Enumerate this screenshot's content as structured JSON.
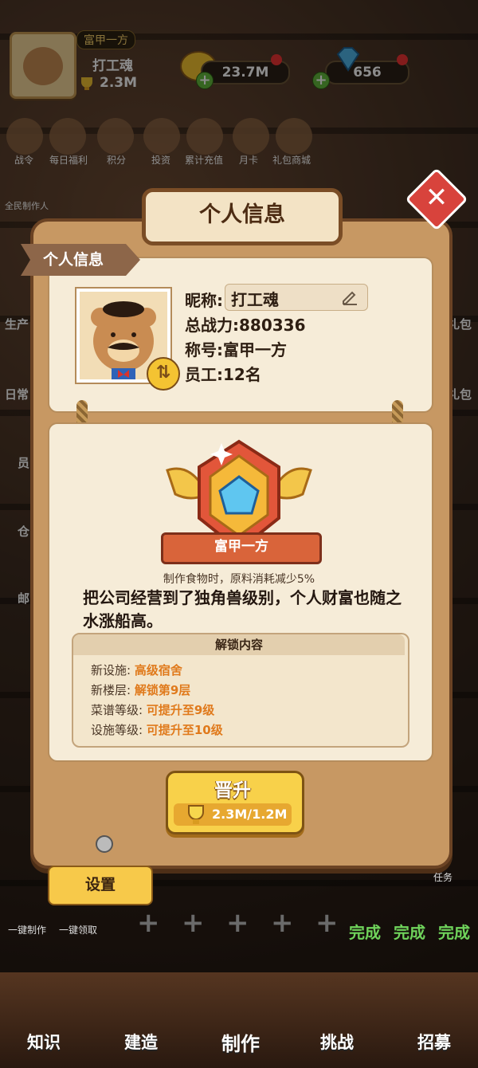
{
  "hud": {
    "rank_tag": "富甲一方",
    "player_name": "打工魂",
    "power": "2.3M",
    "coins": "23.7M",
    "gems": "656"
  },
  "top_row": [
    {
      "label": "战令"
    },
    {
      "label": "每日福利"
    },
    {
      "label": "积分"
    },
    {
      "label": "投资"
    },
    {
      "label": "累计充值"
    },
    {
      "label": "月卡"
    },
    {
      "label": "礼包商城"
    }
  ],
  "side_left": [
    "全民制作人",
    "生产",
    "日常",
    "员",
    "仓",
    "邮"
  ],
  "side_right": [
    "礼包",
    "礼包"
  ],
  "modal": {
    "title": "个人信息",
    "section_ribbon": "个人信息",
    "nickname_label": "昵称:",
    "nickname_value": "打工魂",
    "power_line": "总战力:880336",
    "title_line": "称号:富甲一方",
    "staff_line": "员工:12名",
    "badge_name": "富甲一方",
    "effect": "制作食物时，原料消耗减少5%",
    "description": "把公司经营到了独角兽级别，个人财富也随之水涨船高。",
    "unlock_header": "解锁内容",
    "unlocks": [
      {
        "key": "新设施:",
        "value": "高级宿舍"
      },
      {
        "key": "新楼层:",
        "value": "解锁第9层"
      },
      {
        "key": "菜谱等级:",
        "value": "可提升至9级"
      },
      {
        "key": "设施等级:",
        "value": "可提升至10级"
      }
    ],
    "promote_label": "晋升",
    "promote_cost": "2.3M/1.2M"
  },
  "settings_label": "设置",
  "quick": {
    "one_make": "一键制作",
    "one_collect": "一键领取",
    "task": "任务"
  },
  "done_labels": [
    "完成",
    "完成",
    "完成"
  ],
  "nav": [
    {
      "label": "知识"
    },
    {
      "label": "建造"
    },
    {
      "label": "制作"
    },
    {
      "label": "挑战"
    },
    {
      "label": "招募"
    }
  ],
  "colors": {
    "accent": "#f8d14a",
    "panel": "#c79863",
    "close": "#d8433c"
  }
}
